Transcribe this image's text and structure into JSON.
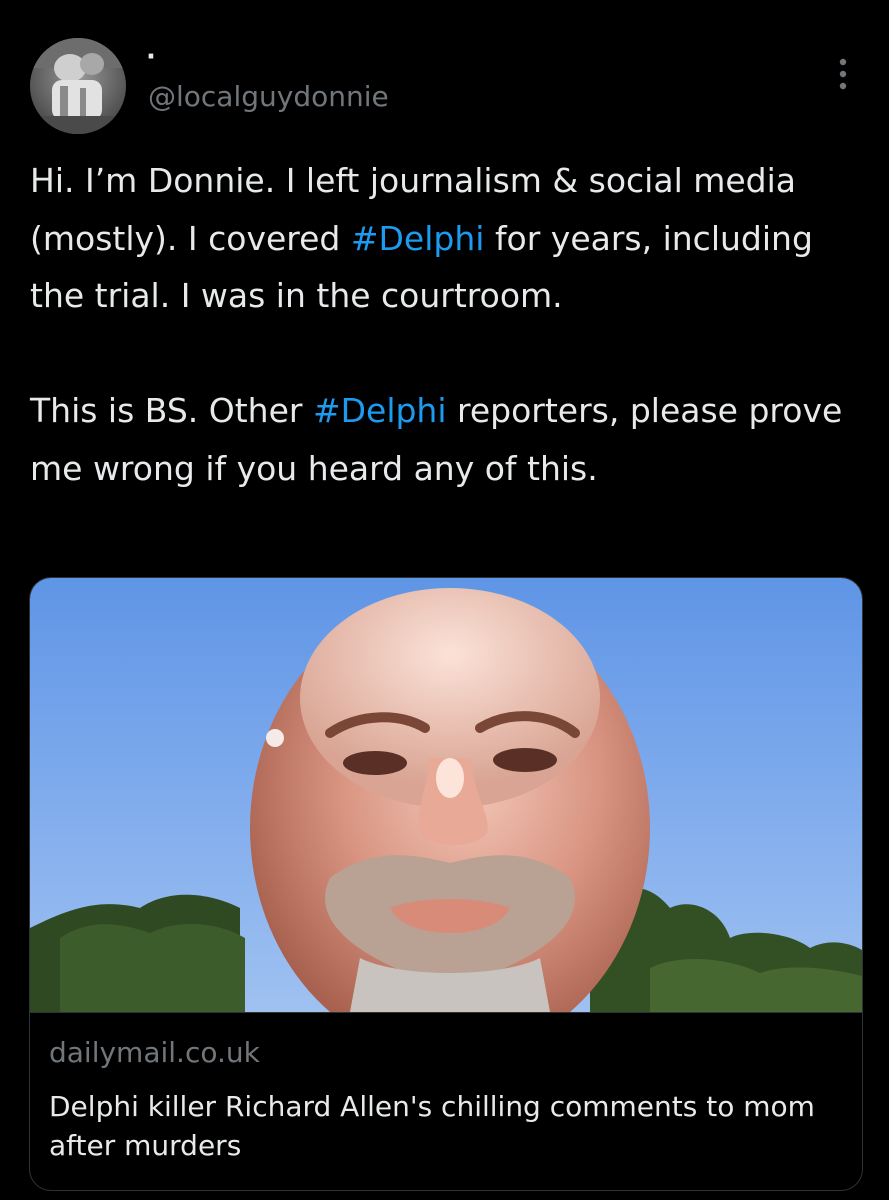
{
  "author": {
    "display_name": "·",
    "handle": "@localguydonnie",
    "avatar_icon": "profile-photo"
  },
  "tweet": {
    "paragraph1": {
      "before": "Hi. I’m Donnie. I left journalism & social media (mostly). I covered ",
      "hashtag": "#Delphi",
      "after": " for years, including the trial. I was in the courtroom."
    },
    "paragraph2": {
      "before": "This is BS. Other ",
      "hashtag": "#Delphi",
      "after": " reporters, please prove me wrong if you heard any of this."
    }
  },
  "link_card": {
    "domain": "dailymail.co.uk",
    "title": "Delphi killer Richard Allen's chilling comments to mom after murders"
  },
  "icons": {
    "more": "more-vertical-icon"
  },
  "colors": {
    "background": "#000000",
    "text": "#e7e9ea",
    "secondary": "#71767b",
    "link": "#1d9bf0",
    "border": "#2f3336"
  }
}
